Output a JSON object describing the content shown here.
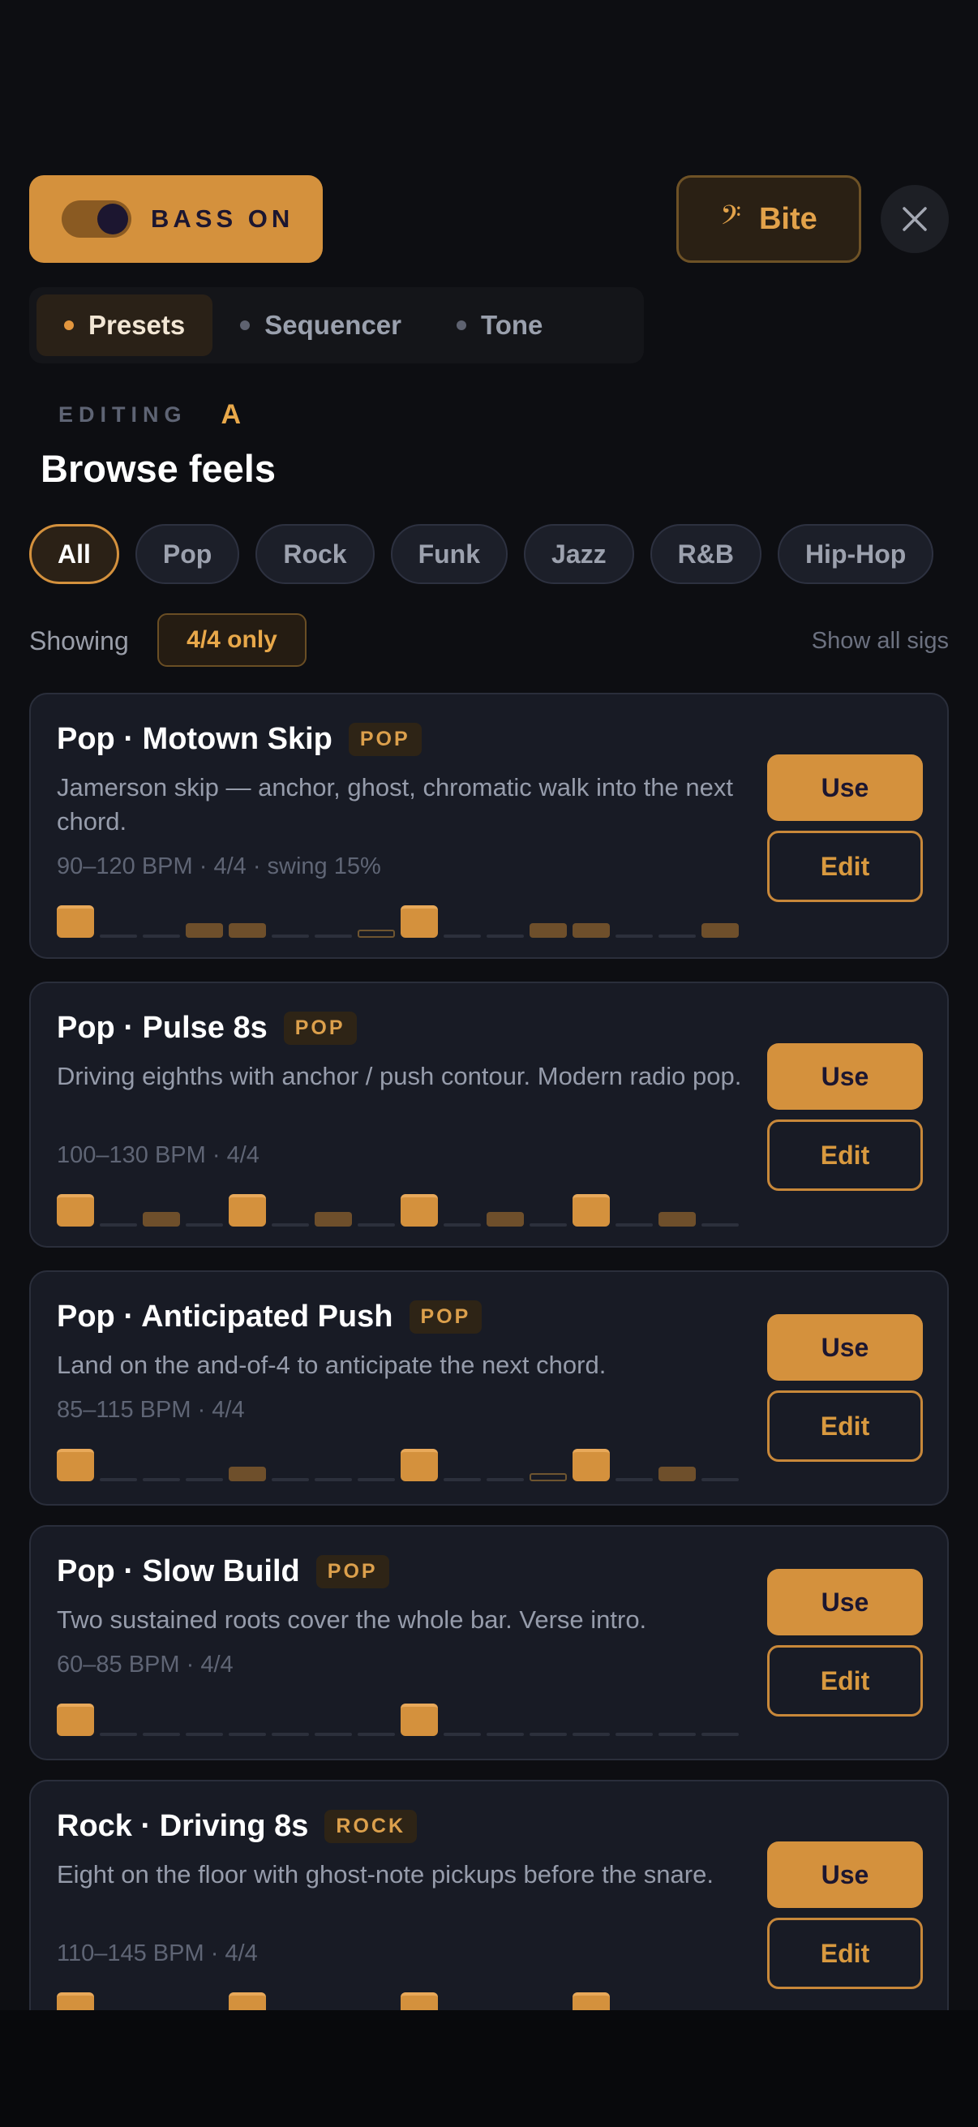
{
  "header": {
    "bass_toggle_label": "BASS ON",
    "bass_toggle_on": true,
    "bite_icon": "𝄢",
    "bite_label": "Bite",
    "close_icon": "close-icon"
  },
  "tabs": [
    {
      "label": "Presets",
      "active": true
    },
    {
      "label": "Sequencer",
      "active": false
    },
    {
      "label": "Tone",
      "active": false
    }
  ],
  "editing": {
    "label": "EDITING",
    "slot": "A"
  },
  "title": "Browse feels",
  "genres": [
    {
      "label": "All",
      "active": true
    },
    {
      "label": "Pop",
      "active": false
    },
    {
      "label": "Rock",
      "active": false
    },
    {
      "label": "Funk",
      "active": false
    },
    {
      "label": "Jazz",
      "active": false
    },
    {
      "label": "R&B",
      "active": false
    },
    {
      "label": "Hip-Hop",
      "active": false
    }
  ],
  "filter": {
    "showing_label": "Showing",
    "sig_badge": "4/4 only",
    "show_all": "Show all sigs"
  },
  "presets": [
    {
      "name": "Pop · Motown Skip",
      "badge": "POP",
      "description": "Jamerson skip — anchor, ghost, chromatic walk into the next chord.",
      "meta": "90–120 BPM  ·  4/4  ·  swing 15%",
      "use_label": "Use",
      "edit_label": "Edit",
      "steps": [
        "anchor",
        "rest",
        "rest",
        "push",
        "push",
        "rest",
        "rest",
        "ghost",
        "anchor",
        "rest",
        "rest",
        "push",
        "push",
        "rest",
        "rest",
        "push"
      ]
    },
    {
      "name": "Pop · Pulse 8s",
      "badge": "POP",
      "description": "Driving eighths with anchor / push contour. Modern radio pop.",
      "meta": "100–130 BPM  ·  4/4",
      "use_label": "Use",
      "edit_label": "Edit",
      "steps": [
        "anchor",
        "rest",
        "push",
        "rest",
        "anchor",
        "rest",
        "push",
        "rest",
        "anchor",
        "rest",
        "push",
        "rest",
        "anchor",
        "rest",
        "push",
        "rest"
      ]
    },
    {
      "name": "Pop · Anticipated Push",
      "badge": "POP",
      "description": "Land on the and-of-4 to anticipate the next chord.",
      "meta": "85–115 BPM  ·  4/4",
      "use_label": "Use",
      "edit_label": "Edit",
      "steps": [
        "anchor",
        "rest",
        "rest",
        "rest",
        "push",
        "rest",
        "rest",
        "rest",
        "anchor",
        "rest",
        "rest",
        "ghost",
        "anchor",
        "rest",
        "push",
        "rest"
      ]
    },
    {
      "name": "Pop · Slow Build",
      "badge": "POP",
      "description": "Two sustained roots cover the whole bar. Verse intro.",
      "meta": "60–85 BPM  ·  4/4",
      "use_label": "Use",
      "edit_label": "Edit",
      "steps": [
        "anchor",
        "rest",
        "rest",
        "rest",
        "rest",
        "rest",
        "rest",
        "rest",
        "anchor",
        "rest",
        "rest",
        "rest",
        "rest",
        "rest",
        "rest",
        "rest"
      ]
    },
    {
      "name": "Rock · Driving 8s",
      "badge": "ROCK",
      "description": "Eight on the floor with ghost-note pickups before the snare.",
      "meta": "110–145 BPM  ·  4/4",
      "use_label": "Use",
      "edit_label": "Edit",
      "steps": [
        "anchor",
        "rest",
        "push",
        "rest",
        "anchor",
        "rest",
        "push",
        "rest",
        "anchor",
        "rest",
        "push",
        "rest",
        "anchor",
        "rest",
        "push",
        "rest"
      ]
    }
  ]
}
